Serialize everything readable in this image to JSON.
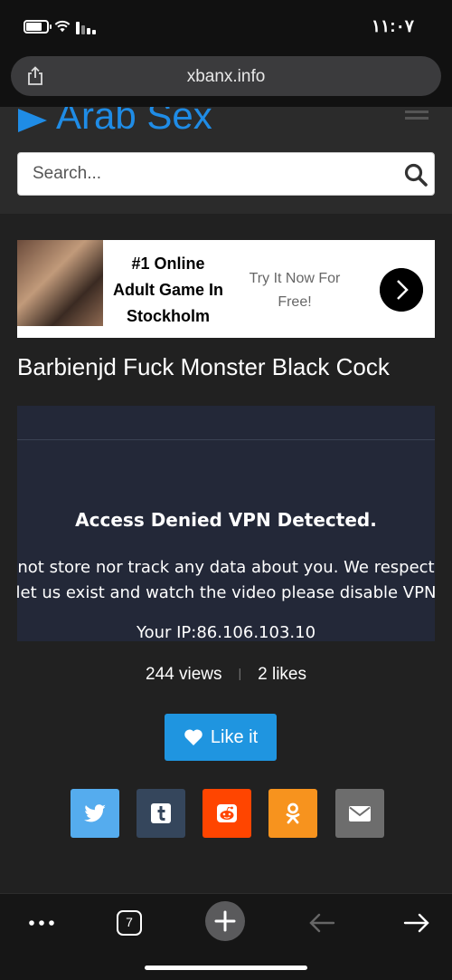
{
  "status_bar": {
    "time": "١١:٠٧",
    "battery_level": 0.7
  },
  "browser": {
    "url": "xbanx.info",
    "tab_count": "7"
  },
  "site": {
    "logo_text": "Arab Sex",
    "search_placeholder": "Search..."
  },
  "ad": {
    "headline": "#1 Online Adult Game In Stockholm",
    "cta": "Try It Now For Free!"
  },
  "video": {
    "title": "Barbienjd Fuck Monster Black Cock",
    "notice_title": "Access Denied VPN Detected.",
    "notice_line1": "not store nor track any data about you. We respect",
    "notice_line2": "let us exist and watch the video please disable VPN",
    "ip_line": "Your IP:86.106.103.10"
  },
  "stats": {
    "views": "244 views",
    "likes": "2 likes"
  },
  "like_button": {
    "label": "Like it"
  },
  "share": [
    {
      "name": "twitter",
      "color": "#55acee"
    },
    {
      "name": "tumblr",
      "color": "#35465c"
    },
    {
      "name": "reddit",
      "color": "#ff4500"
    },
    {
      "name": "odnoklassniki",
      "color": "#f7931e"
    },
    {
      "name": "email",
      "color": "#6d6d6d"
    }
  ],
  "colors": {
    "accent": "#1f8ce6",
    "like": "#1f95e0",
    "background": "#212121"
  }
}
